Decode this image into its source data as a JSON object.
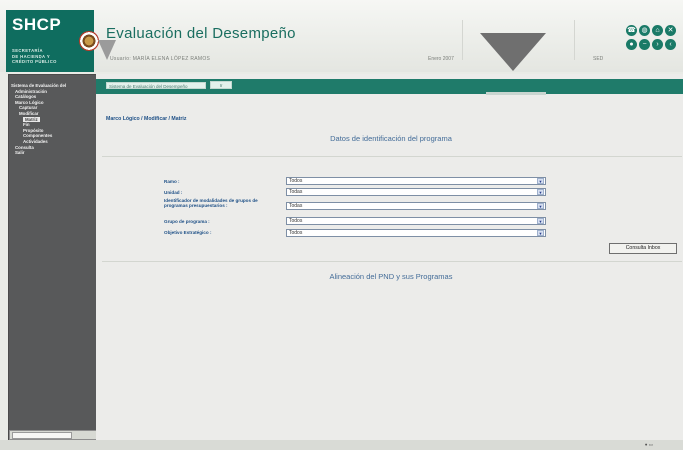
{
  "header": {
    "brand": "SHCP",
    "brand_sub": [
      "SECRETARÍA",
      "DE HACIENDA Y",
      "CRÉDITO PÚBLICO"
    ],
    "title": "Evaluación del Desempeño",
    "user_line": "Usuario: MARÍA ELENA LÓPEZ RAMOS",
    "date": "Enero 2007",
    "code": "SED",
    "icons": [
      "phone-icon",
      "globe-icon",
      "home-icon",
      "close-icon",
      "nav-icon",
      "minus-icon",
      "forward-icon",
      "back-icon"
    ]
  },
  "sidebar": {
    "items": [
      {
        "label": "Sistema de Evaluación del",
        "level": 1
      },
      {
        "label": "Administración",
        "level": 2
      },
      {
        "label": "Catálogos",
        "level": 2
      },
      {
        "label": "Marco Lógico",
        "level": 2
      },
      {
        "label": "Capturar",
        "level": 3
      },
      {
        "label": "Modificar",
        "level": 3
      },
      {
        "label": "Matriz",
        "level": 4,
        "selected": true
      },
      {
        "label": "Fin",
        "level": 4
      },
      {
        "label": "Propósito",
        "level": 4
      },
      {
        "label": "Componentes",
        "level": 4
      },
      {
        "label": "Actividades",
        "level": 4
      },
      {
        "label": "Consulta",
        "level": 2
      },
      {
        "label": "Salir",
        "level": 2
      }
    ]
  },
  "toolbar": {
    "input_value": "Sistema de Evaluación del Desempeño",
    "button_label": "Ir"
  },
  "breadcrumb": "Marco Lógico / Modificar / Matriz",
  "section1_title": "Datos de identificación del programa",
  "section2_title": "Alineación del PND y sus Programas",
  "form": {
    "fields": [
      {
        "label": "Ramo :",
        "value": "Todos"
      },
      {
        "label": "Unidad :",
        "value": "Todas"
      },
      {
        "label": "Identificador de modalidades de grupos de programas presupuestarios :",
        "value": "Todas"
      },
      {
        "label": "Grupo de programa :",
        "value": "Todos"
      },
      {
        "label": "Objetivo Estratégico :",
        "value": "Todos"
      }
    ],
    "consult_button": "Consulta Inbox"
  }
}
